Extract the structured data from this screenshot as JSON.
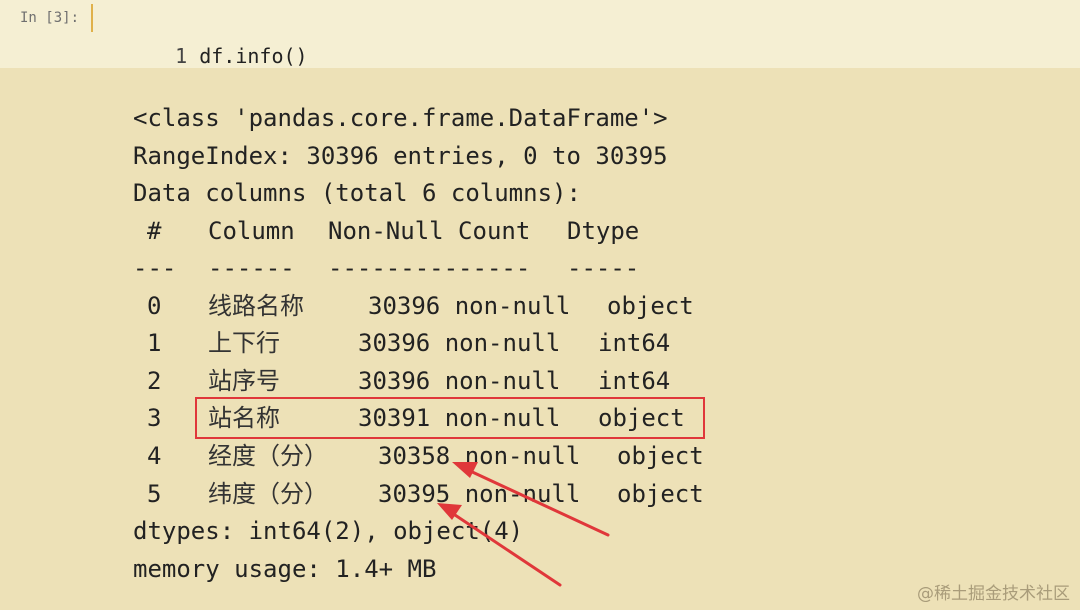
{
  "input_cell": {
    "prompt": "In [3]:",
    "line_number": "1",
    "code": "df.info()"
  },
  "output": {
    "class_line": "<class 'pandas.core.frame.DataFrame'>",
    "range_index": "RangeIndex: 30396 entries, 0 to 30395",
    "data_columns": "Data columns (total 6 columns):",
    "header": {
      "hash": "#",
      "column": "Column",
      "non_null": "Non-Null Count",
      "dtype": "Dtype"
    },
    "separator": {
      "hash": "---",
      "column": "------",
      "non_null": "--------------",
      "dtype": "-----"
    },
    "rows": [
      {
        "idx": "0",
        "column": "线路名称",
        "non_null": "30396 non-null",
        "dtype": "object"
      },
      {
        "idx": "1",
        "column": "上下行",
        "non_null": "30396 non-null",
        "dtype": "int64"
      },
      {
        "idx": "2",
        "column": "站序号",
        "non_null": "30396 non-null",
        "dtype": "int64"
      },
      {
        "idx": "3",
        "column": "站名称",
        "non_null": "30391 non-null",
        "dtype": "object"
      },
      {
        "idx": "4",
        "column": "经度（分）",
        "non_null": "30358 non-null",
        "dtype": "object"
      },
      {
        "idx": "5",
        "column": "纬度（分）",
        "non_null": "30395 non-null",
        "dtype": "object"
      }
    ],
    "dtypes_line": "dtypes: int64(2), object(4)",
    "memory_line": "memory usage: 1.4+ MB"
  },
  "annotation_colors": {
    "highlight": "#e0373a",
    "arrow": "#e0373a"
  },
  "watermark": "@稀土掘金技术社区"
}
